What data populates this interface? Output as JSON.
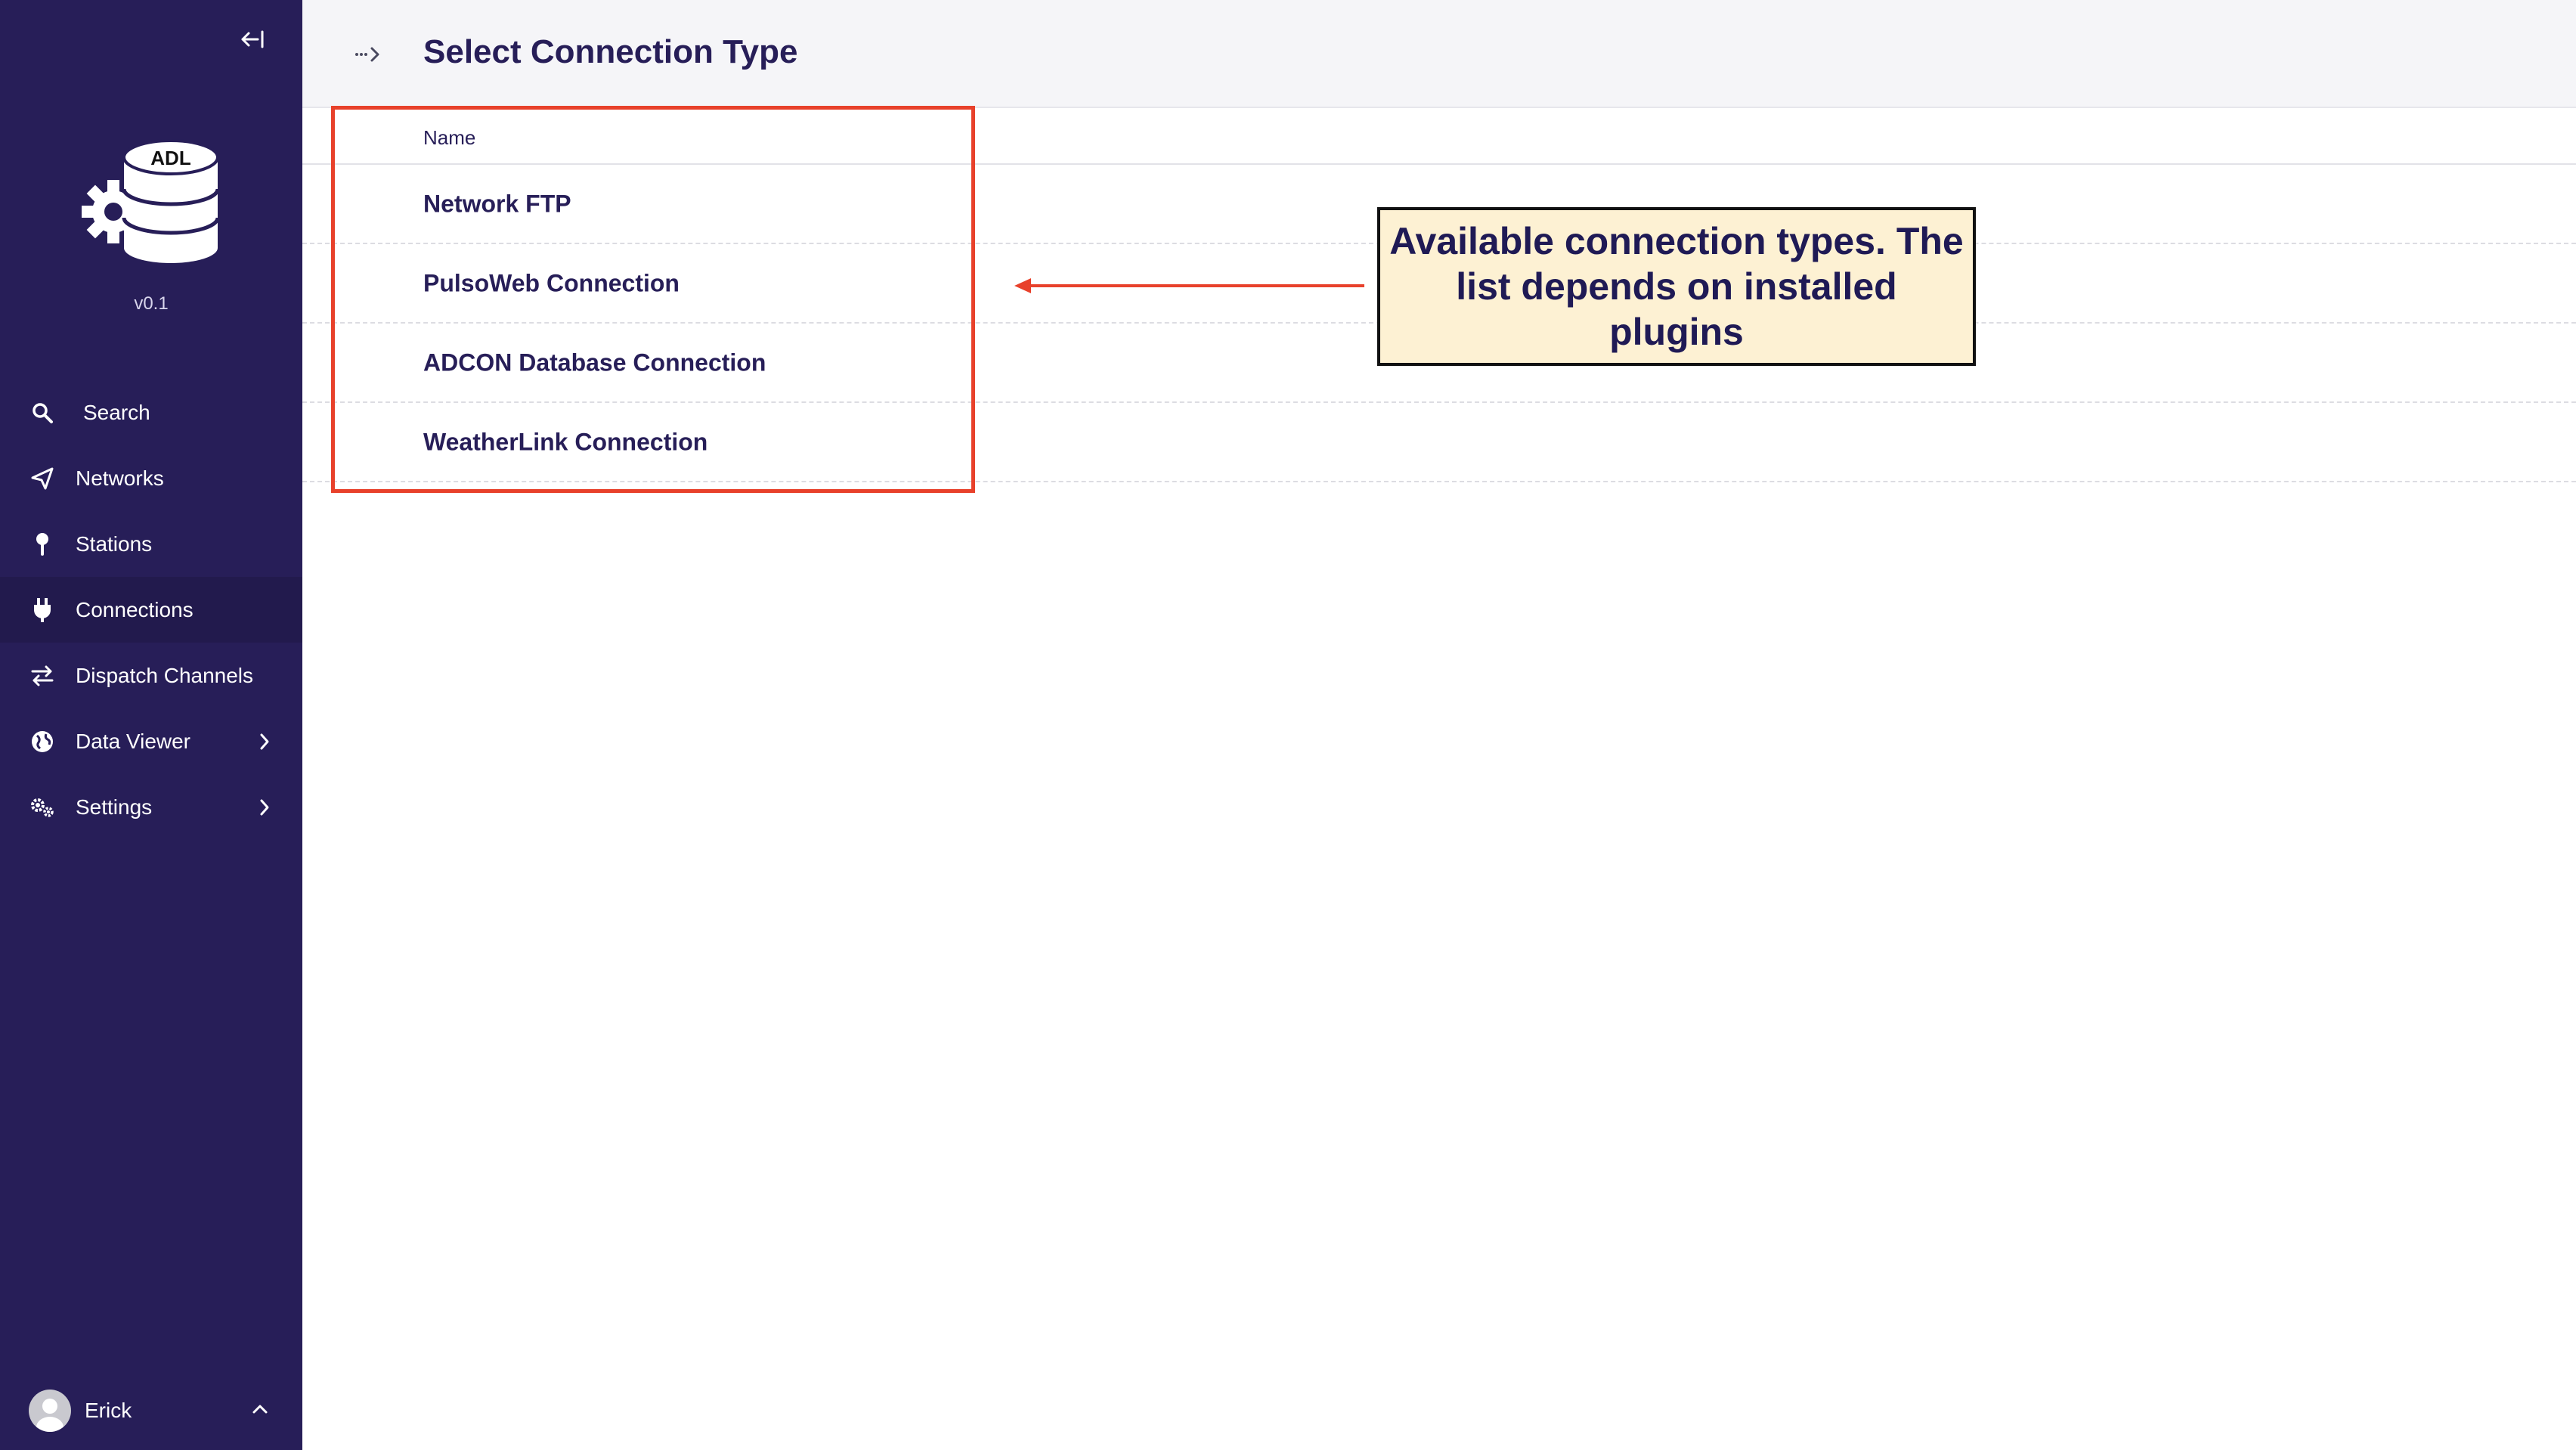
{
  "sidebar": {
    "logo_text": "ADL",
    "version": "v0.1",
    "items": [
      {
        "label": "Search",
        "icon": "search-icon"
      },
      {
        "label": "Networks",
        "icon": "send-icon"
      },
      {
        "label": "Stations",
        "icon": "pin-icon"
      },
      {
        "label": "Connections",
        "icon": "plug-icon",
        "active": true
      },
      {
        "label": "Dispatch Channels",
        "icon": "swap-icon"
      },
      {
        "label": "Data Viewer",
        "icon": "globe-icon",
        "has_submenu": true
      },
      {
        "label": "Settings",
        "icon": "gears-icon",
        "has_submenu": true
      }
    ],
    "user": {
      "name": "Erick"
    }
  },
  "header": {
    "title": "Select Connection Type"
  },
  "table": {
    "column_header": "Name",
    "rows": [
      "Network FTP",
      "PulsoWeb Connection",
      "ADCON Database Connection",
      "WeatherLink Connection"
    ]
  },
  "annotation": {
    "callout_text": "Available connection types. The list depends on installed plugins"
  },
  "colors": {
    "sidebar_bg": "#271e58",
    "sidebar_active": "#221a4d",
    "text_primary": "#271e58",
    "annotation_red": "#e8412b",
    "callout_bg": "#fdf1d3"
  }
}
